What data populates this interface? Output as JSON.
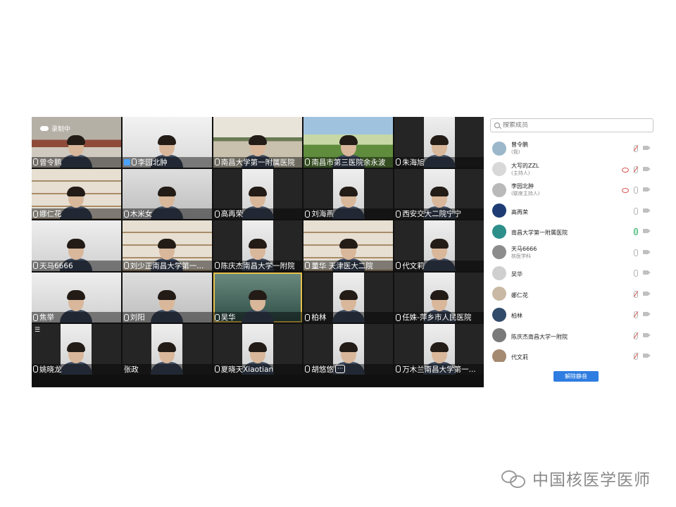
{
  "recording_label": "录制中",
  "tiles": [
    {
      "name": "曾令鹏",
      "bg": "office"
    },
    {
      "name": "李园北肿",
      "bg": "white",
      "icon": "user"
    },
    {
      "name": "南昌大学第一附属医院",
      "bg": "meeting"
    },
    {
      "name": "南昌市第三医院余永波",
      "bg": "land"
    },
    {
      "name": "朱海旭",
      "bg": "dark",
      "narrow": true
    },
    {
      "name": "娜仁花",
      "bg": "shelf"
    },
    {
      "name": "木米女",
      "bg": "grey"
    },
    {
      "name": "高再荣",
      "bg": "dark",
      "narrow": true
    },
    {
      "name": "刘海燕",
      "bg": "dark",
      "narrow": true
    },
    {
      "name": "西安交大二院宁宁",
      "bg": "dark",
      "narrow": true
    },
    {
      "name": "天马6666",
      "bg": "lite"
    },
    {
      "name": "刘少正南昌大学第一...",
      "bg": "shelf"
    },
    {
      "name": "陈庆杰南昌大学一附院",
      "bg": "dark",
      "narrow": true
    },
    {
      "name": "董华 天津医大二院",
      "bg": "shelf"
    },
    {
      "name": "代文莉",
      "bg": "dark",
      "narrow": true
    },
    {
      "name": "焦举",
      "bg": "lite"
    },
    {
      "name": "刘阳",
      "bg": "grey"
    },
    {
      "name": "吴华",
      "bg": "teal",
      "active": true
    },
    {
      "name": "柏林",
      "bg": "dark",
      "narrow": true
    },
    {
      "name": "任姝-萍乡市人民医院",
      "bg": "dark",
      "narrow": true
    },
    {
      "name": "姚晓龙",
      "bg": "dark",
      "narrow": true,
      "bars": true
    },
    {
      "name": "张政",
      "bg": "dark",
      "narrow": true,
      "nomic": true
    },
    {
      "name": "夏晓天Xiaotian",
      "bg": "dark",
      "narrow": true
    },
    {
      "name": "胡悠悠",
      "bg": "dark",
      "narrow": true,
      "dots": true
    },
    {
      "name": "万木兰南昌大学第一...",
      "bg": "dark",
      "narrow": true
    }
  ],
  "panel": {
    "search_placeholder": "搜索成员",
    "members": [
      {
        "name": "曾令鹏",
        "role": "(我)",
        "mic": "muted",
        "avatar": "#9bb7c9"
      },
      {
        "name": "大写的ZZL",
        "role": "(主持人)",
        "mic": "muted",
        "eye": true,
        "avatar": "#d8d8d8"
      },
      {
        "name": "李园北肿",
        "role": "(联席主持人)",
        "mic": "normal",
        "eye": true,
        "avatar": "#b9b9b9"
      },
      {
        "name": "高再荣",
        "role": "",
        "mic": "normal",
        "avatar": "#1e3c73"
      },
      {
        "name": "南昌大学第一附属医院",
        "role": "",
        "mic": "green",
        "avatar": "#2e8f8a"
      },
      {
        "name": "天马6666",
        "role": "核医学科",
        "mic": "normal",
        "avatar": "#8c8c8c"
      },
      {
        "name": "吴华",
        "role": "",
        "mic": "normal",
        "avatar": "#cfcfcf"
      },
      {
        "name": "娜仁花",
        "role": "",
        "mic": "muted",
        "avatar": "#c9b9a4"
      },
      {
        "name": "柏林",
        "role": "",
        "mic": "muted",
        "avatar": "#334b6b"
      },
      {
        "name": "陈庆杰南昌大学一附院",
        "role": "",
        "mic": "muted",
        "avatar": "#7a7a7a"
      },
      {
        "name": "代文莉",
        "role": "",
        "mic": "muted",
        "avatar": "#a58a72"
      }
    ],
    "unmute_label": "解除静音"
  },
  "watermark": "中国核医学医师"
}
